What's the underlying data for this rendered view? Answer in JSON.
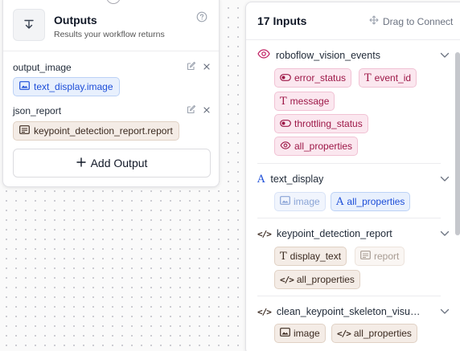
{
  "outputs": {
    "title": "Outputs",
    "subtitle": "Results your workflow returns",
    "items": [
      {
        "label": "output_image",
        "value": "text_display.image"
      },
      {
        "label": "json_report",
        "value": "keypoint_detection_report.report"
      }
    ],
    "add_label": "Add Output"
  },
  "inputs": {
    "title": "17 Inputs",
    "drag_label": "Drag to Connect",
    "groups": [
      {
        "name": "roboflow_vision_events",
        "chips": [
          "error_status",
          "event_id",
          "message",
          "throttling_status",
          "all_properties"
        ]
      },
      {
        "name": "text_display",
        "chips": [
          "image",
          "all_properties"
        ]
      },
      {
        "name": "keypoint_detection_report",
        "chips": [
          "display_text",
          "report",
          "all_properties"
        ]
      },
      {
        "name": "clean_keypoint_skeleton_visua...",
        "chips": [
          "image",
          "all_properties"
        ]
      }
    ]
  },
  "colors": {
    "pink_chip": "#9d1747",
    "blue_chip": "#1d4ed8",
    "brown_chip": "#3b2a20"
  }
}
